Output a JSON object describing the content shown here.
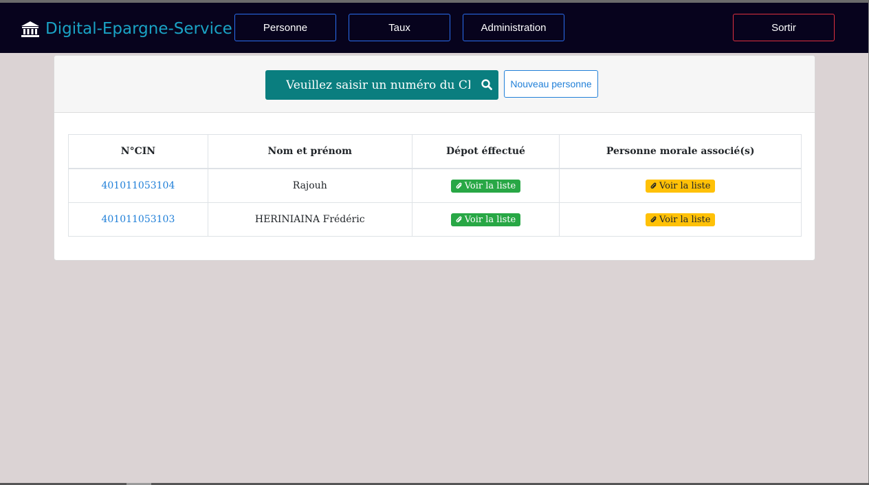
{
  "brand": {
    "title": "Digital-Epargne-Service",
    "icon": "bank-icon"
  },
  "nav": {
    "personne": "Personne",
    "taux": "Taux",
    "administration": "Administration",
    "sortir": "Sortir"
  },
  "search": {
    "placeholder": "Veuillez saisir un numéro du CIN",
    "icon": "search-icon"
  },
  "new_person_label": "Nouveau personne",
  "table": {
    "headers": [
      "N°CIN",
      "Nom et prénom",
      "Dépot éffectué",
      "Personne morale associé(s)"
    ],
    "rows": [
      {
        "cin": "401011053104",
        "name": "Rajouh",
        "depot": "Voir la liste",
        "morale": "Voir la liste"
      },
      {
        "cin": "401011053103",
        "name": "HERINIAINA Frédéric",
        "depot": "Voir la liste",
        "morale": "Voir la liste"
      }
    ]
  },
  "colors": {
    "navbar": "#07031d",
    "brand": "#1aa3c5",
    "search": "#0a7e7f",
    "success": "#28a745",
    "warning": "#ffc107",
    "danger": "#e0303f",
    "primary": "#1f7fd8"
  }
}
